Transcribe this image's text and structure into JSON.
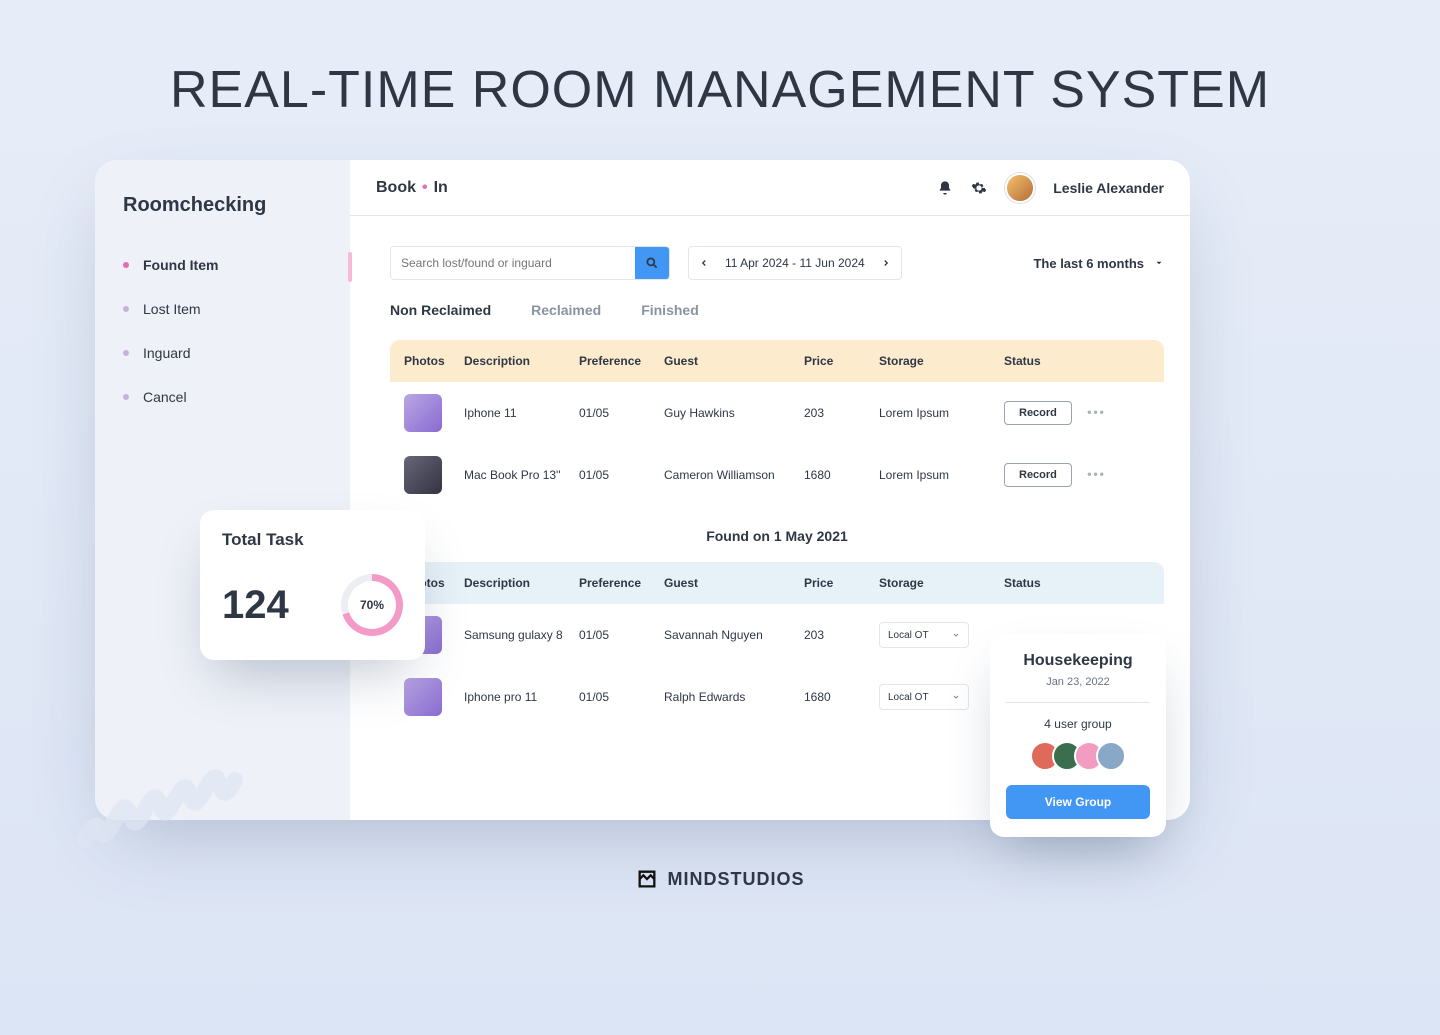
{
  "hero_title": "REAL-TIME ROOM MANAGEMENT SYSTEM",
  "sidebar": {
    "brand": "Roomchecking",
    "items": [
      {
        "label": "Found Item",
        "active": true
      },
      {
        "label": "Lost Item"
      },
      {
        "label": "Inguard"
      },
      {
        "label": "Cancel"
      }
    ]
  },
  "topbar": {
    "logo_book": "Book",
    "logo_in": "In",
    "username": "Leslie Alexander"
  },
  "filters": {
    "search_placeholder": "Search lost/found or inguard",
    "date_range": "11 Apr 2024 - 11 Jun 2024",
    "period_label": "The last 6 months"
  },
  "tabs": [
    {
      "label": "Non Reclaimed",
      "active": true
    },
    {
      "label": "Reclaimed"
    },
    {
      "label": "Finished"
    }
  ],
  "columns": {
    "photos": "Photos",
    "description": "Description",
    "preference": "Preference",
    "guest": "Guest",
    "price": "Price",
    "storage": "Storage",
    "status": "Status"
  },
  "table_a_rows": [
    {
      "thumb": "phone",
      "description": "Iphone 11",
      "preference": "01/05",
      "guest": "Guy Hawkins",
      "price": "203",
      "storage": "Lorem Ipsum",
      "action": "Record"
    },
    {
      "thumb": "laptop",
      "description": "Mac Book Pro 13''",
      "preference": "01/05",
      "guest": "Cameron Williamson",
      "price": "1680",
      "storage": "Lorem Ipsum",
      "action": "Record"
    }
  ],
  "found_on": "Found on 1 May 2021",
  "table_b_rows": [
    {
      "thumb": "phone",
      "description": "Samsung gulaxy 8",
      "preference": "01/05",
      "guest": "Savannah Nguyen",
      "price": "203",
      "storage": "Local OT"
    },
    {
      "thumb": "phone",
      "description": "Iphone pro 11",
      "preference": "01/05",
      "guest": "Ralph Edwards",
      "price": "1680",
      "storage": "Local OT"
    }
  ],
  "task_card": {
    "title": "Total Task",
    "count": "124",
    "percent": "70%"
  },
  "hk_card": {
    "title": "Housekeeping",
    "date": "Jan 23, 2022",
    "subtitle": "4 user group",
    "button": "View Group"
  },
  "mindstudios": "MINDSTUDIOS"
}
